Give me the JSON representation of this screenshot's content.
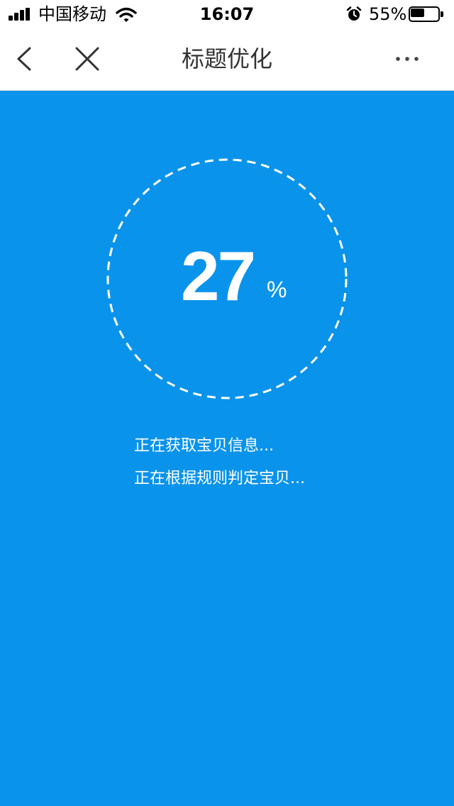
{
  "status_bar": {
    "carrier": "中国移动",
    "time": "16:07",
    "battery_percent": "55%",
    "battery_level": 0.55,
    "signal_bars": 4,
    "icons": [
      "signal-icon",
      "wifi-icon",
      "alarm-icon",
      "battery-icon"
    ]
  },
  "nav": {
    "title": "标题优化",
    "back_icon": "chevron-left-icon",
    "close_icon": "close-icon",
    "more_icon": "more-horizontal-icon"
  },
  "progress": {
    "value": "27",
    "unit": "%",
    "fraction": 0.27
  },
  "status_lines": [
    "正在获取宝贝信息...",
    "正在根据规则判定宝贝..."
  ],
  "colors": {
    "background": "#0a93eb",
    "nav_background": "#ffffff",
    "foreground": "#ffffff",
    "title": "#333333"
  }
}
